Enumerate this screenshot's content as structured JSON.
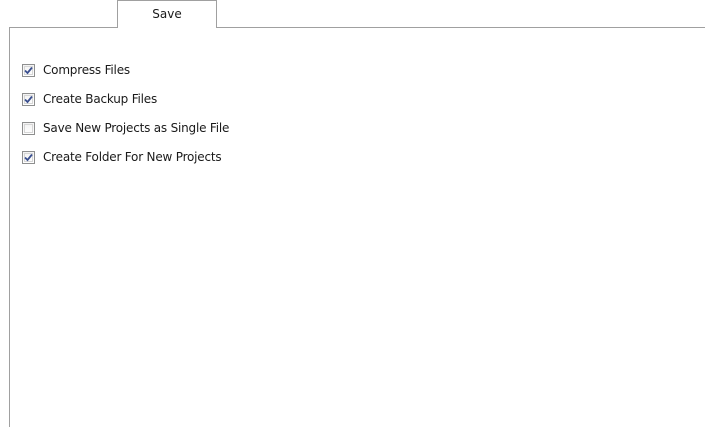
{
  "tabs": [
    {
      "label": "Save",
      "selected": true
    }
  ],
  "options": [
    {
      "label": "Compress Files",
      "checked": true
    },
    {
      "label": "Create Backup Files",
      "checked": true
    },
    {
      "label": "Save New Projects as Single File",
      "checked": false
    },
    {
      "label": "Create Folder For New Projects",
      "checked": true
    }
  ],
  "colors": {
    "checkmark": "#3a4f8f",
    "border": "#a0a0a0"
  }
}
